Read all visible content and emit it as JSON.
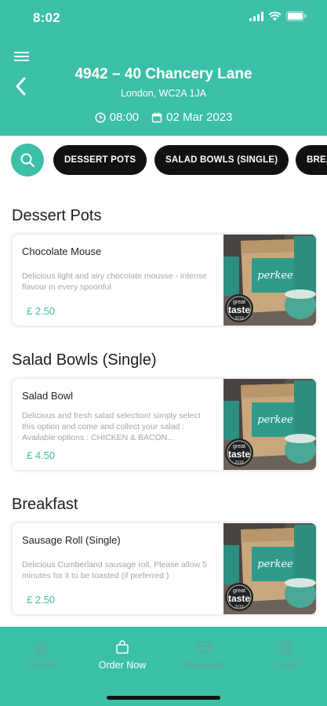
{
  "status_bar": {
    "time": "8:02"
  },
  "header": {
    "title": "4942 – 40 Chancery Lane",
    "address": "London, WC2A 1JA",
    "time": "08:00",
    "date": "02 Mar 2023"
  },
  "categories": [
    "DESSERT POTS",
    "SALAD BOWLS (SINGLE)",
    "BREAKFAST"
  ],
  "sections": [
    {
      "title": "Dessert Pots",
      "item": {
        "name": "Chocolate Mouse",
        "description": "Delicious light and airy chocolate mousse - intense flavour in every spoonful",
        "price": "£ 2.50"
      }
    },
    {
      "title": "Salad Bowls (Single)",
      "item": {
        "name": "Salad Bowl",
        "description": "Delicious and fresh salad selection! simply select this option and come and collect your salad : Available options : CHICKEN & BACON...",
        "price": "£ 4.50"
      }
    },
    {
      "title": "Breakfast",
      "item": {
        "name": "Sausage Roll (Single)",
        "description": "Delicious Cumberland sausage roll, Please allow 5 minutes for it to be toasted (if preferred )",
        "price": "£ 2.50"
      }
    }
  ],
  "product_image": {
    "brand": "perkee",
    "badge_top": "great",
    "badge_main": "taste",
    "badge_year": "2019"
  },
  "tabs": [
    {
      "label": "Home",
      "icon": "home-icon"
    },
    {
      "label": "Order Now",
      "icon": "bag-icon"
    },
    {
      "label": "Rewards",
      "icon": "rewards-icon"
    },
    {
      "label": "Login",
      "icon": "user-icon"
    }
  ],
  "colors": {
    "brand": "#3cbfa7",
    "chip": "#111111",
    "inactive_tab": "#5fa596"
  }
}
